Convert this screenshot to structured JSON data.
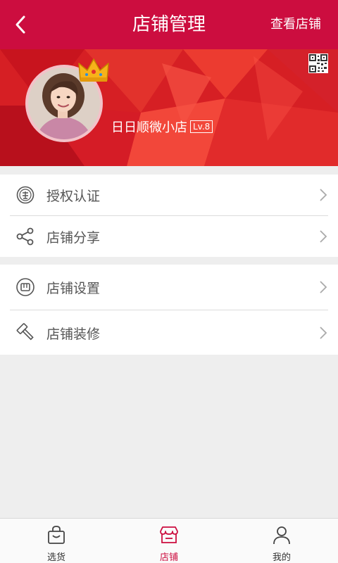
{
  "header": {
    "title": "店铺管理",
    "right_action": "查看店铺"
  },
  "profile": {
    "store_name": "日日顺微小店",
    "level": "Lv.8"
  },
  "menu": {
    "group1": [
      {
        "label": "授权认证",
        "icon": "auth-badge-icon"
      },
      {
        "label": "店铺分享",
        "icon": "share-icon"
      }
    ],
    "group2": [
      {
        "label": "店铺设置",
        "icon": "store-settings-icon"
      },
      {
        "label": "店铺装修",
        "icon": "hammer-icon"
      }
    ]
  },
  "tabs": [
    {
      "label": "选货",
      "icon": "shopping-bag-icon",
      "active": false
    },
    {
      "label": "店铺",
      "icon": "storefront-icon",
      "active": true
    },
    {
      "label": "我的",
      "icon": "user-icon",
      "active": false
    }
  ],
  "colors": {
    "brand": "#cc0d3f",
    "banner": "#d71d26"
  }
}
